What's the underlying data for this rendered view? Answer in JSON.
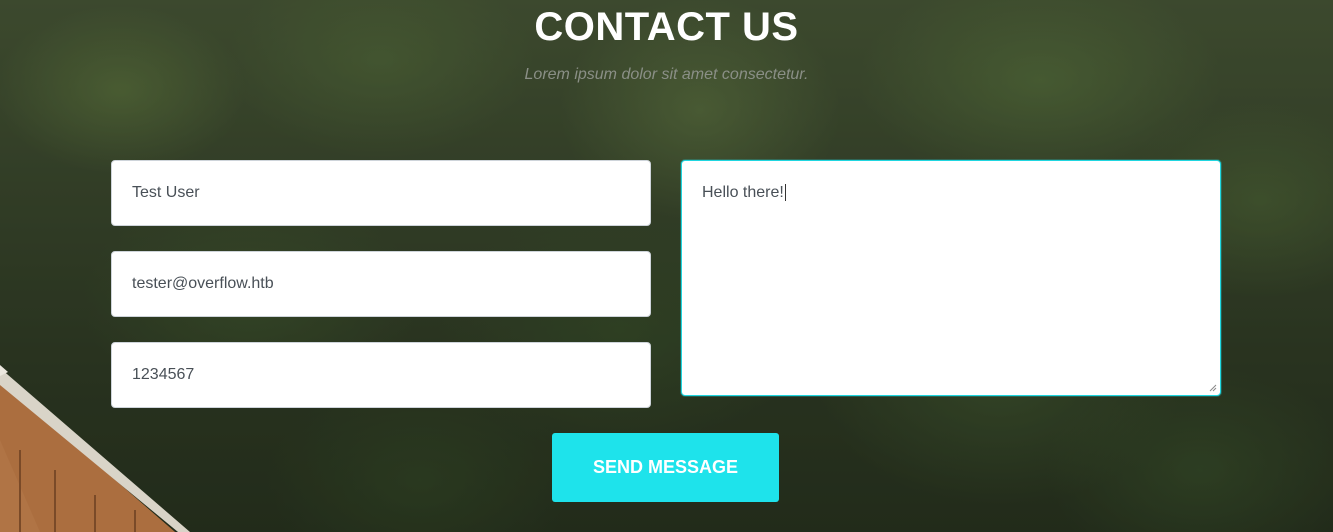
{
  "section": {
    "title": "CONTACT US",
    "subtitle": "Lorem ipsum dolor sit amet consectetur."
  },
  "form": {
    "name_value": "Test User",
    "email_value": "tester@overflow.htb",
    "phone_value": "1234567",
    "message_value": "Hello there!",
    "submit_label": "SEND MESSAGE"
  },
  "colors": {
    "accent": "#1ee3eb",
    "focus_border": "#1fd6e0",
    "input_text": "#495057",
    "heading": "#ffffff"
  }
}
